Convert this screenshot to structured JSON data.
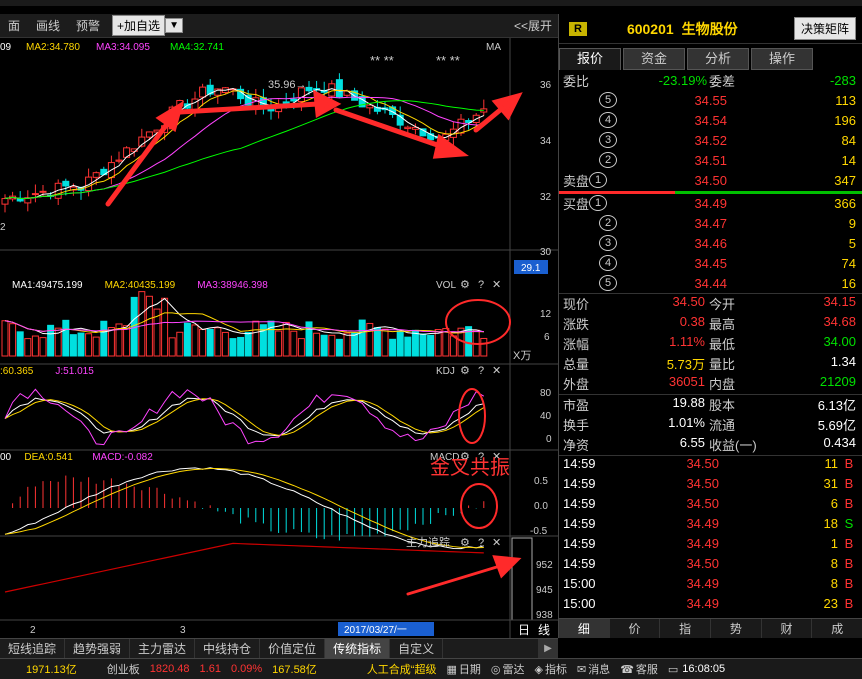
{
  "toolbar": {
    "items": [
      "面",
      "画线",
      "预警"
    ],
    "add_watch": "+加自选",
    "expand": "<<展开"
  },
  "main": {
    "ma_legend": [
      {
        "label": "09",
        "color": "#ffffff"
      },
      {
        "label": "MA2:34.780",
        "color": "#ffd700"
      },
      {
        "label": "MA3:34.095",
        "color": "#ff44ff"
      },
      {
        "label": "MA4:32.741",
        "color": "#00ff00"
      }
    ],
    "ma_tag": "MA",
    "stars": [
      "** **",
      "** **"
    ],
    "high_label": "35.96→",
    "axis_labels": [
      "36",
      "34",
      "32",
      "30"
    ],
    "last_price_tag": "29.1",
    "left_label": "2"
  },
  "vol": {
    "legend": [
      {
        "label": "MA1:49475.199",
        "color": "#ffffff"
      },
      {
        "label": "MA2:40435.199",
        "color": "#ffd700"
      },
      {
        "label": "MA3:38946.398",
        "color": "#ff44ff"
      }
    ],
    "name": "VOL",
    "axis_labels": [
      "12",
      "6"
    ],
    "unit": "X万"
  },
  "kdj": {
    "legend": [
      {
        "label": ":60.365",
        "color": "#ffd700"
      },
      {
        "label": "J:51.015",
        "color": "#ff44ff"
      }
    ],
    "name": "KDJ",
    "axis_labels": [
      "80",
      "40",
      "0"
    ]
  },
  "macd": {
    "legend": [
      {
        "label": "00",
        "color": "#ffffff"
      },
      {
        "label": "DEA:0.541",
        "color": "#ffd700"
      },
      {
        "label": "MACD:-0.082",
        "color": "#ff44ff"
      }
    ],
    "name": "MACD",
    "axis_labels": [
      "0.5",
      "0.0",
      "-0.5"
    ],
    "annotation": "金叉共振"
  },
  "zlzz": {
    "name": "主力追踪",
    "axis_labels": [
      "952",
      "945",
      "938"
    ]
  },
  "xaxis": {
    "labels": [
      "2",
      "3"
    ],
    "date_tag": "2017/03/27/一",
    "period_day": "日",
    "period_line": "线"
  },
  "bottom_tabs": [
    "短线追踪",
    "趋势强弱",
    "主力雷达",
    "中线持仓",
    "价值定位",
    "传统指标",
    "自定义"
  ],
  "active_bottom_tab": "传统指标",
  "panel": {
    "tag": "R",
    "code": "600201",
    "name": "生物股份",
    "decision_btn": "决策矩阵",
    "tabs": [
      "报价",
      "资金",
      "分析",
      "操作"
    ],
    "webi_label": "委比",
    "webi_value": "-23.19%",
    "weicha_label": "委差",
    "weicha_value": "-283",
    "sell_label": "卖盘",
    "buy_label": "买盘",
    "sell": [
      {
        "level": "5",
        "price": "34.55",
        "vol": "113"
      },
      {
        "level": "4",
        "price": "34.54",
        "vol": "196"
      },
      {
        "level": "3",
        "price": "34.52",
        "vol": "84"
      },
      {
        "level": "2",
        "price": "34.51",
        "vol": "14"
      },
      {
        "level": "1",
        "price": "34.50",
        "vol": "347"
      }
    ],
    "buy": [
      {
        "level": "1",
        "price": "34.49",
        "vol": "366"
      },
      {
        "level": "2",
        "price": "34.47",
        "vol": "9"
      },
      {
        "level": "3",
        "price": "34.46",
        "vol": "5"
      },
      {
        "level": "4",
        "price": "34.45",
        "vol": "74"
      },
      {
        "level": "5",
        "price": "34.44",
        "vol": "16"
      }
    ],
    "quotes": [
      {
        "l1": "现价",
        "v1": "34.50",
        "c1": "red",
        "l2": "今开",
        "v2": "34.15",
        "c2": "red"
      },
      {
        "l1": "涨跌",
        "v1": "0.38",
        "c1": "red",
        "l2": "最高",
        "v2": "34.68",
        "c2": "red"
      },
      {
        "l1": "涨幅",
        "v1": "1.11%",
        "c1": "red",
        "l2": "最低",
        "v2": "34.00",
        "c2": "green"
      },
      {
        "l1": "总量",
        "v1": "5.73万",
        "c1": "yellow",
        "l2": "量比",
        "v2": "1.34",
        "c2": "white"
      },
      {
        "l1": "外盘",
        "v1": "36051",
        "c1": "red",
        "l2": "内盘",
        "v2": "21209",
        "c2": "green"
      }
    ],
    "fundamentals": [
      {
        "l1": "市盈",
        "v1": "19.88",
        "l2": "股本",
        "v2": "6.13亿"
      },
      {
        "l1": "换手",
        "v1": "1.01%",
        "l2": "流通",
        "v2": "5.69亿"
      },
      {
        "l1": "净资",
        "v1": "6.55",
        "l2": "收益(一)",
        "v2": "0.434"
      }
    ],
    "trades": [
      {
        "t": "14:59",
        "p": "34.50",
        "v": "11",
        "s": "B"
      },
      {
        "t": "14:59",
        "p": "34.50",
        "v": "31",
        "s": "B"
      },
      {
        "t": "14:59",
        "p": "34.50",
        "v": "6",
        "s": "B"
      },
      {
        "t": "14:59",
        "p": "34.49",
        "v": "18",
        "s": "S"
      },
      {
        "t": "14:59",
        "p": "34.49",
        "v": "1",
        "s": "B"
      },
      {
        "t": "14:59",
        "p": "34.50",
        "v": "8",
        "s": "B"
      },
      {
        "t": "15:00",
        "p": "34.49",
        "v": "8",
        "s": "B"
      },
      {
        "t": "15:00",
        "p": "34.49",
        "v": "23",
        "s": "B"
      }
    ],
    "bottom_tabs": [
      "细",
      "价",
      "指",
      "势",
      "财",
      "成"
    ]
  },
  "status": {
    "index1_value": "1971.13亿",
    "gem_label": "创业板",
    "gem_value": "1820.48",
    "gem_change": "1.61",
    "gem_pct": "0.09%",
    "gem_amount": "167.58亿",
    "ticker": "人工合成“超级",
    "items": [
      "日期",
      "雷达",
      "指标",
      "消息",
      "客服"
    ],
    "time": "16:08:05"
  },
  "colors": {
    "up": "#ff3333",
    "down": "#00e000",
    "ma1": "#ffffff",
    "ma2": "#ffd700",
    "ma3": "#ff44ff",
    "ma4": "#00ff00",
    "bar_up": "#ff3333",
    "bar_down": "#00e0e0",
    "annotation": "#ff3333"
  }
}
